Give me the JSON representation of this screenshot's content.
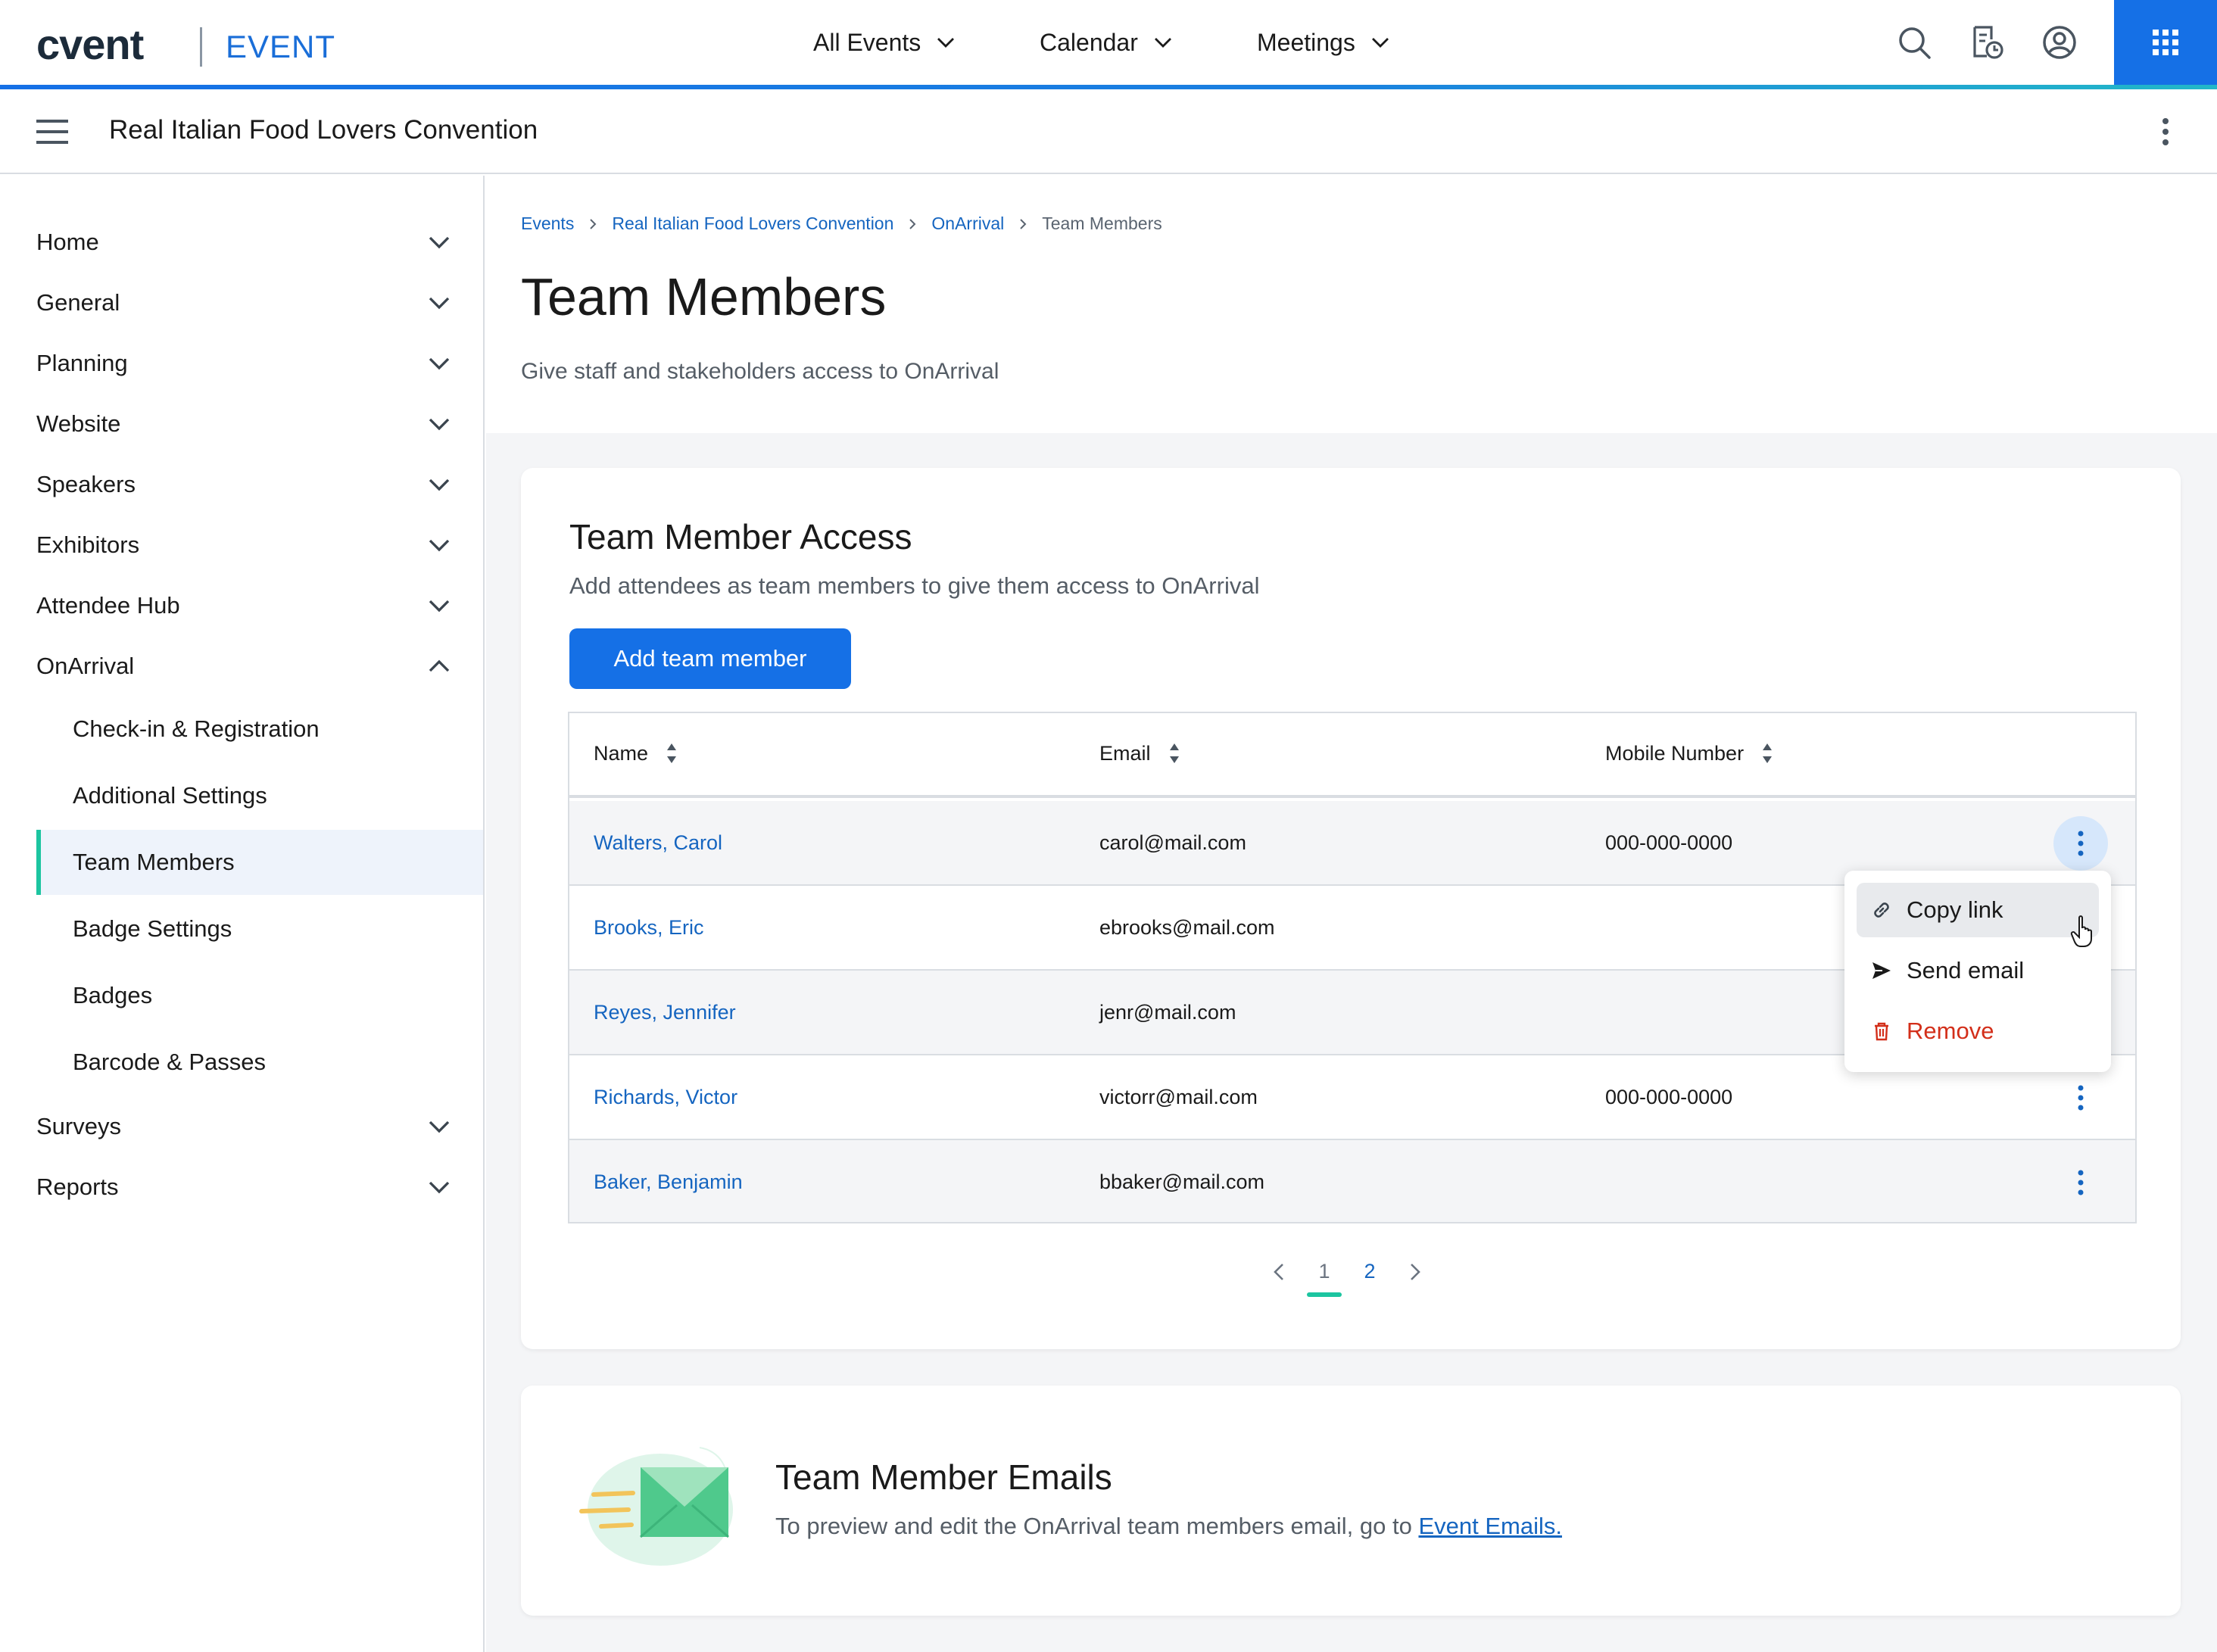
{
  "colors": {
    "accent": "#1570e6",
    "link": "#1565c0",
    "active_marker": "#1cc5a0",
    "danger": "#d32f1a"
  },
  "header": {
    "logo": "cvent",
    "product": "EVENT",
    "nav": [
      {
        "label": "All Events"
      },
      {
        "label": "Calendar"
      },
      {
        "label": "Meetings"
      }
    ],
    "icons": [
      "search-icon",
      "report-history-icon",
      "account-icon",
      "app-grid-icon"
    ]
  },
  "subheader": {
    "event_title": "Real Italian Food Lovers Convention"
  },
  "sidebar": {
    "items": [
      {
        "label": "Home"
      },
      {
        "label": "General"
      },
      {
        "label": "Planning"
      },
      {
        "label": "Website"
      },
      {
        "label": "Speakers"
      },
      {
        "label": "Exhibitors"
      },
      {
        "label": "Attendee Hub"
      },
      {
        "label": "OnArrival"
      },
      {
        "label": "Surveys"
      },
      {
        "label": "Reports"
      }
    ],
    "onarrival_children": [
      {
        "label": "Check-in & Registration"
      },
      {
        "label": "Additional Settings"
      },
      {
        "label": "Team Members"
      },
      {
        "label": "Badge Settings"
      },
      {
        "label": "Badges"
      },
      {
        "label": "Barcode & Passes"
      }
    ],
    "active_child": "Team Members"
  },
  "breadcrumb": [
    {
      "label": "Events"
    },
    {
      "label": "Real Italian Food Lovers Convention"
    },
    {
      "label": "OnArrival"
    },
    {
      "label": "Team Members"
    }
  ],
  "page": {
    "title": "Team Members",
    "subtitle": "Give staff and stakeholders access to OnArrival"
  },
  "access_card": {
    "title": "Team Member Access",
    "subtitle": "Add attendees as team members to give them access to OnArrival",
    "add_button": "Add team member",
    "columns": [
      "Name",
      "Email",
      "Mobile Number"
    ],
    "rows": [
      {
        "name": "Walters, Carol",
        "email": "carol@mail.com",
        "mobile": "000-000-0000"
      },
      {
        "name": "Brooks, Eric",
        "email": "ebrooks@mail.com",
        "mobile": ""
      },
      {
        "name": "Reyes, Jennifer",
        "email": "jenr@mail.com",
        "mobile": ""
      },
      {
        "name": "Richards, Victor",
        "email": "victorr@mail.com",
        "mobile": "000-000-0000"
      },
      {
        "name": "Baker, Benjamin",
        "email": "bbaker@mail.com",
        "mobile": ""
      }
    ],
    "row_menu": {
      "items": [
        {
          "label": "Copy link",
          "icon": "link-icon"
        },
        {
          "label": "Send email",
          "icon": "send-icon"
        },
        {
          "label": "Remove",
          "icon": "trash-icon"
        }
      ]
    },
    "pagination": {
      "pages": [
        "1",
        "2"
      ],
      "current": "1"
    }
  },
  "emails_card": {
    "title": "Team Member Emails",
    "text": "To preview and edit the OnArrival team members email, go to",
    "link": "Event Emails."
  }
}
